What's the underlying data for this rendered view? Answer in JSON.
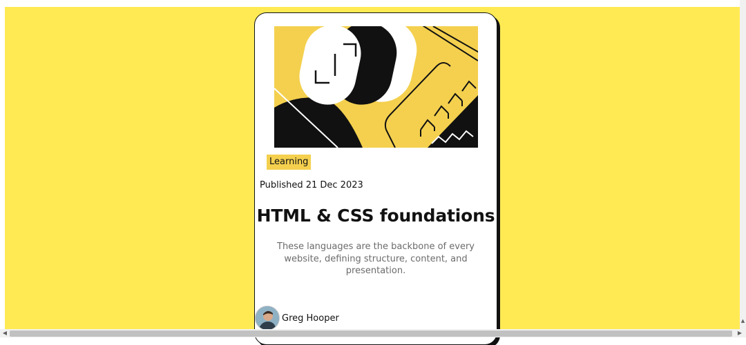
{
  "card": {
    "tag": "Learning",
    "published": "Published 21 Dec 2023",
    "title": "HTML & CSS foundations",
    "description": "These languages are the backbone of every website, defining structure, content, and presentation.",
    "author_name": "Greg Hooper"
  },
  "colors": {
    "page_background": "#ffea54",
    "card_background": "#ffffff",
    "accent_yellow": "#f4d04e",
    "text_dark": "#111111",
    "text_muted": "#6b6b6b"
  },
  "icons": {
    "scroll_left": "◀",
    "scroll_right": "▶",
    "scroll_up": "▲",
    "scroll_down": "▼"
  }
}
